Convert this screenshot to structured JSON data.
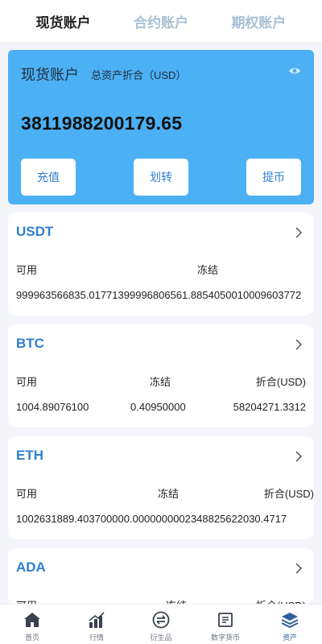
{
  "tabs": [
    "现货账户",
    "合约账户",
    "期权账户"
  ],
  "account": {
    "title": "现货账户",
    "subtitle": "总资产折合（USD）",
    "total": "3811988200179.65",
    "actions": [
      "充值",
      "划转",
      "提币"
    ]
  },
  "coins": [
    {
      "name": "USDT",
      "available_label": "可用",
      "frozen_label": "冻结",
      "value_label": "",
      "combined": "999963566835.01771399996806561.8854050010009603772"
    },
    {
      "name": "BTC",
      "available_label": "可用",
      "frozen_label": "冻结",
      "value_label": "折合(USD)",
      "available": "1004.89076100",
      "frozen": "0.40950000",
      "value": "58204271.3312"
    },
    {
      "name": "ETH",
      "available_label": "可用",
      "frozen_label": "冻结",
      "value_label": "折合(USD)",
      "combined": "1002631889.403700000.0000000002348825622030.4717"
    },
    {
      "name": "ADA",
      "available_label": "可用",
      "frozen_label": "冻结",
      "value_label": "折合(USD)"
    }
  ],
  "nav": [
    {
      "label": "首页",
      "icon": "home-icon"
    },
    {
      "label": "行情",
      "icon": "market-icon"
    },
    {
      "label": "衍生品",
      "icon": "derivatives-icon"
    },
    {
      "label": "数字货币",
      "icon": "digital-currency-icon"
    },
    {
      "label": "资产",
      "icon": "assets-icon"
    }
  ],
  "colors": {
    "accent": "#4cb0f5",
    "brand_text": "#2f7fd0",
    "background": "#f4f5fa"
  }
}
